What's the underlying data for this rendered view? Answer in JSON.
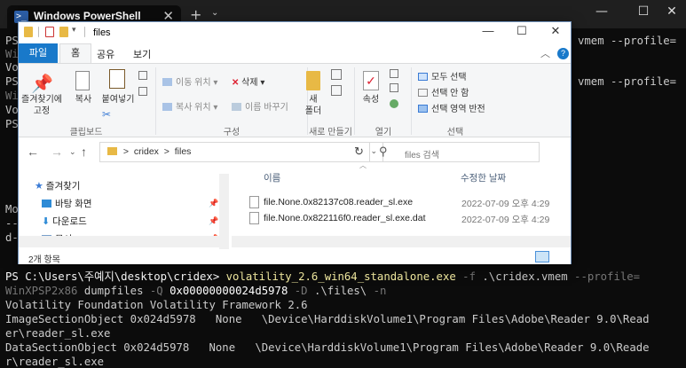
{
  "powershell": {
    "tab_icon": "powershell-icon",
    "tab_title": "Windows PowerShell",
    "new_tab_icon": "plus-icon",
    "tab_menu_icon": "chevron-down-icon",
    "terminal_visible_fragments": {
      "l1_prefix": "PS",
      "l1_suffix": "vmem --profile=",
      "l2": "Wi",
      "l3": "Vo",
      "l4_prefix": "PS",
      "l4_suffix": "vmem --profile=",
      "l5": "Wi",
      "l6": "Vo",
      "l7": "PS",
      "l8": "Mo",
      "l9": "--",
      "l10": "d-"
    },
    "command_line": {
      "prompt": "PS C:\\Users\\주예지\\desktop\\cridex> ",
      "exe": "volatility_2.6_win64_standalone.exe",
      "flag_f": " -f ",
      "file": ".\\cridex.vmem",
      "flag_profile": " --profile="
    },
    "command_line2": {
      "profile": "WinXPSP2x86",
      "plugin": " dumpfiles ",
      "flag_q": "-Q ",
      "offset": "0x00000000024d5978",
      "flag_d": " -D ",
      "dir": ".\\files\\ ",
      "flag_n": "-n"
    },
    "output": [
      "Volatility Foundation Volatility Framework 2.6",
      "ImageSectionObject 0x024d5978   None   \\Device\\HarddiskVolume1\\Program Files\\Adobe\\Reader 9.0\\Read",
      "er\\reader_sl.exe",
      "DataSectionObject 0x024d5978   None   \\Device\\HarddiskVolume1\\Program Files\\Adobe\\Reader 9.0\\Reade",
      "r\\reader_sl.exe"
    ]
  },
  "explorer": {
    "title": "files",
    "ribbon_tabs": {
      "file": "파일",
      "home": "홈",
      "share": "공유",
      "view": "보기"
    },
    "clipboard": {
      "pin_quick": "즐겨찾기에\n고정",
      "copy": "복사",
      "paste": "붙여넣기",
      "group": "클립보드"
    },
    "organize": {
      "move_to": "이동 위치",
      "copy_to": "복사 위치",
      "delete": "삭제",
      "rename": "이름 바꾸기",
      "group": "구성"
    },
    "new": {
      "new_folder": "새\n폴더",
      "group": "새로 만들기"
    },
    "open": {
      "properties": "속성",
      "group": "열기"
    },
    "select": {
      "select_all": "모두 선택",
      "select_none": "선택 안 함",
      "invert": "선택 영역 반전",
      "group": "선택"
    },
    "address": {
      "segment1": "cridex",
      "segment2": "files",
      "separator": ">"
    },
    "search_placeholder": "files 검색",
    "nav": {
      "quick_access": "즐겨찾기",
      "desktop": "바탕 화면",
      "downloads": "다운로드",
      "documents": "문서"
    },
    "columns": {
      "name": "이름",
      "date_modified": "수정한 날짜"
    },
    "files": [
      {
        "name": "file.None.0x82137c08.reader_sl.exe",
        "date": "2022-07-09 오후 4:29"
      },
      {
        "name": "file.None.0x822116f0.reader_sl.exe.dat",
        "date": "2022-07-09 오후 4:29"
      }
    ],
    "status": "2개 항목"
  }
}
